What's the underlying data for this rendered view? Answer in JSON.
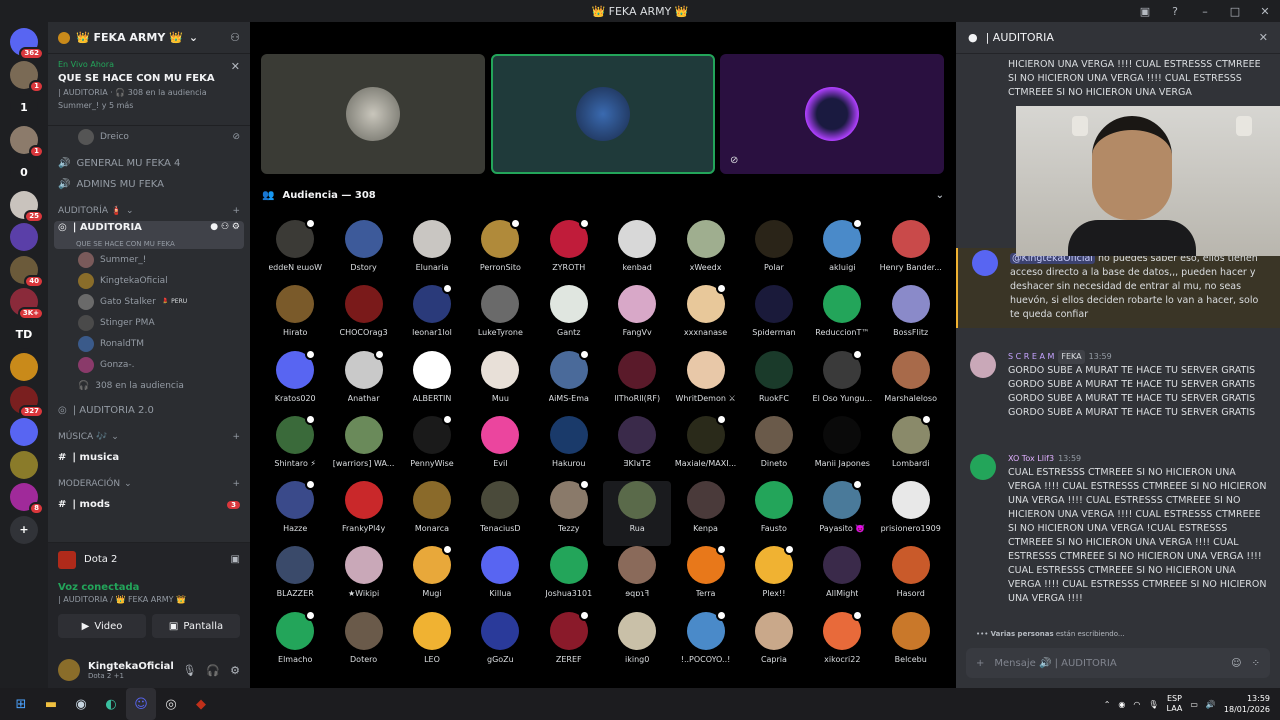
{
  "window": {
    "title": "👑 FEKA ARMY 👑"
  },
  "servers": [
    {
      "label": "",
      "badge": "362",
      "color": "#5865f2"
    },
    {
      "label": "",
      "badge": "1",
      "color": "#7a6a55"
    },
    {
      "label": "1",
      "badge": "",
      "color": "#1e1f22"
    },
    {
      "label": "",
      "badge": "1",
      "color": "#8c7b6b"
    },
    {
      "label": "0",
      "badge": "",
      "color": "#1e1f22"
    },
    {
      "label": "",
      "badge": "25",
      "color": "#c9c3bd"
    },
    {
      "label": "",
      "badge": "",
      "color": "#5a3fa8"
    },
    {
      "label": "",
      "badge": "40",
      "color": "#6b5a3a"
    },
    {
      "label": "",
      "badge": "3K+",
      "color": "#8a2a3a"
    },
    {
      "label": "TD",
      "badge": "",
      "color": "#1e1f22"
    },
    {
      "label": "",
      "badge": "",
      "color": "#c98a1a"
    },
    {
      "label": "",
      "badge": "327",
      "color": "#7a1f1f"
    },
    {
      "label": "",
      "badge": "",
      "color": "#5865f2"
    },
    {
      "label": "",
      "badge": "",
      "color": "#8a7b2a"
    },
    {
      "label": "",
      "badge": "8",
      "color": "#a02a9a"
    },
    {
      "label": "+",
      "badge": "",
      "color": "#313338"
    }
  ],
  "guild": {
    "name": "👑 FEKA ARMY 👑"
  },
  "live": {
    "status": "En Vivo Ahora",
    "title": "QUE SE HACE CON MU FEKA",
    "info": "| AUDITORIA · 🎧 308 en la audiencia",
    "users": "Summer_! y 5 más"
  },
  "channels": {
    "top_user": "Dreico",
    "general": "GENERAL MU FEKA 4",
    "admins": "ADMINS MU FEKA",
    "cat_auditoria": "AUDITORÍA 🧯",
    "auditoria": "| AUDITORIA",
    "auditoria_sub": "QUE SE HACE CON MU FEKA",
    "voice_users": [
      {
        "name": "Summer_!",
        "tag": ""
      },
      {
        "name": "KingtekaOficial",
        "tag": ""
      },
      {
        "name": "Gato Stalker",
        "tag": "💄 PERU"
      },
      {
        "name": "Stinger PMA",
        "tag": ""
      },
      {
        "name": "RonaldTM",
        "tag": ""
      },
      {
        "name": "Gonza-.",
        "tag": ""
      }
    ],
    "audience_count": "308 en la audiencia",
    "auditoria2": "| AUDITORIA 2.0",
    "cat_musica": "MÚSICA 🎶",
    "musica": "| musica",
    "cat_moderacion": "MODERACIÓN",
    "mods": "| mods",
    "mods_badge": "3"
  },
  "game": {
    "name": "Dota 2"
  },
  "voice": {
    "status": "Voz conectada",
    "server": "| AUDITORIA / 👑 FEKA ARMY 👑",
    "video": "Video",
    "screen": "Pantalla"
  },
  "user": {
    "name": "KingtekaOficial",
    "status": "Dota 2 +1"
  },
  "audience": {
    "header": "Audiencia — 308"
  },
  "audience_members": [
    {
      "name": "ɐddɐN ɐɯoW",
      "color": "#3b3a36"
    },
    {
      "name": "Dstory",
      "color": "#3d5a9a"
    },
    {
      "name": "Elunaria",
      "color": "#c9c6c2"
    },
    {
      "name": "PerronSito",
      "color": "#b08a3a"
    },
    {
      "name": "ZYROTH",
      "color": "#c01c3a"
    },
    {
      "name": "kenbad",
      "color": "#d8d8d8"
    },
    {
      "name": "xWeedx",
      "color": "#9fae8f"
    },
    {
      "name": "Polar",
      "color": "#2a2418"
    },
    {
      "name": "akluigi",
      "color": "#4a8ac9"
    },
    {
      "name": "Henry Bander...",
      "color": "#c94a4a"
    },
    {
      "name": "Hirato",
      "color": "#7a5a2a"
    },
    {
      "name": "CHOCOrag3",
      "color": "#7a1a1a"
    },
    {
      "name": "leonar1lol",
      "color": "#2a3a7a"
    },
    {
      "name": "LukeTyrone",
      "color": "#6a6a6a"
    },
    {
      "name": "Gantz",
      "color": "#e0e6e0"
    },
    {
      "name": "FangVv",
      "color": "#d8a8c8"
    },
    {
      "name": "xxxnanase",
      "color": "#e8c89a"
    },
    {
      "name": "Spiderman",
      "color": "#1a1a3a"
    },
    {
      "name": "ReduccionT™",
      "color": "#23a55a"
    },
    {
      "name": "BossFlitz",
      "color": "#8a8ac9"
    },
    {
      "name": "Kratos020",
      "color": "#5865f2"
    },
    {
      "name": "Anathar",
      "color": "#c9c9c9"
    },
    {
      "name": "ALBERTIN",
      "color": "#ffffff"
    },
    {
      "name": "Muu",
      "color": "#e8e0d8"
    },
    {
      "name": "AiMS-Ema",
      "color": "#4a6a9a"
    },
    {
      "name": "lIThoRll(RF)",
      "color": "#5a1a2a"
    },
    {
      "name": "WhritDemon ⚔",
      "color": "#e8c8a8"
    },
    {
      "name": "RuokFC",
      "color": "#1a3a2a"
    },
    {
      "name": "El Oso Yungu...",
      "color": "#3a3a3a"
    },
    {
      "name": "Marshaleloso",
      "color": "#a86a4a"
    },
    {
      "name": "Shintaro ⚡",
      "color": "#3a6a3a"
    },
    {
      "name": "[warriors] WA...",
      "color": "#6a8a5a"
    },
    {
      "name": "PennyWise",
      "color": "#1a1a1a"
    },
    {
      "name": "Evil",
      "color": "#eb459e"
    },
    {
      "name": "Hakurou",
      "color": "#1a3a6a"
    },
    {
      "name": "ƎKIᴚTƧ",
      "color": "#3a2a4a"
    },
    {
      "name": "Maxiale/MAXI...",
      "color": "#2a2a1a"
    },
    {
      "name": "Dineto",
      "color": "#6a5a4a"
    },
    {
      "name": "Manii Japones",
      "color": "#0a0a0a"
    },
    {
      "name": "Lombardi",
      "color": "#8a8a6a"
    },
    {
      "name": "Hazze",
      "color": "#3a4a8a"
    },
    {
      "name": "FrankyPl4y",
      "color": "#c9282a"
    },
    {
      "name": "Monarca",
      "color": "#8a6a2a"
    },
    {
      "name": "TenaciusD",
      "color": "#4a4a3a"
    },
    {
      "name": "Tezzy",
      "color": "#8a7a6a"
    },
    {
      "name": "Rua",
      "color": "#5a6a4a"
    },
    {
      "name": "Kenpa",
      "color": "#4a3a3a"
    },
    {
      "name": "Fausto",
      "color": "#23a55a"
    },
    {
      "name": "Payasito 👿",
      "color": "#4a7a9a"
    },
    {
      "name": "prisionero1909",
      "color": "#e8e8e8"
    },
    {
      "name": "BLAZZER",
      "color": "#3a4a6a"
    },
    {
      "name": "★Wikipi",
      "color": "#c9a8b8"
    },
    {
      "name": "Mugi",
      "color": "#e8a83a"
    },
    {
      "name": "Killua",
      "color": "#5865f2"
    },
    {
      "name": "Joshua3101",
      "color": "#23a55a"
    },
    {
      "name": "ɘqɒɿꟻ",
      "color": "#8a6a5a"
    },
    {
      "name": "Terra",
      "color": "#e8781a"
    },
    {
      "name": "Plex!!",
      "color": "#f0b232"
    },
    {
      "name": "AllMight",
      "color": "#3a2a4a"
    },
    {
      "name": "Hasord",
      "color": "#c95a2a"
    },
    {
      "name": "Elmacho",
      "color": "#23a55a"
    },
    {
      "name": "Dotero",
      "color": "#6a5a4a"
    },
    {
      "name": "LEO",
      "color": "#f0b232"
    },
    {
      "name": "gGoZu",
      "color": "#2a3a9a"
    },
    {
      "name": "ZEREF",
      "color": "#8a1a2a"
    },
    {
      "name": "iking0",
      "color": "#c9c0a8"
    },
    {
      "name": "!..POCOYO..!",
      "color": "#4a8ac9"
    },
    {
      "name": "Capria",
      "color": "#c9a88a"
    },
    {
      "name": "xikocri22",
      "color": "#e86a3a"
    },
    {
      "name": "Belcebu",
      "color": "#c9782a"
    }
  ],
  "chat": {
    "header": "| AUDITORIA",
    "msg1_text": "HICIERON UNA VERGA !!!! CUAL ESTRESSS CTMREEE SI NO HICIERON UNA VERGA !!!! CUAL ESTRESSS CTMREEE SI NO HICIERON UNA VERGA",
    "msg2_mention": "@KingtekaOficial",
    "msg2_text": "no puedes saber eso, ellos tienen acceso directo a la base de datos,,, pueden hacer y deshacer sin necesidad de entrar al mu, no seas huevón, si ellos deciden robarte lo van a hacer, solo te queda confiar",
    "msg3_author": "S C R E A M",
    "msg3_tag": "FEKA",
    "msg3_time": "13:59",
    "msg3_text": "GORDO SUBE A MURAT TE HACE TU SERVER GRATIS GORDO SUBE A MURAT TE HACE TU SERVER GRATIS GORDO SUBE A MURAT TE HACE TU SERVER GRATIS GORDO SUBE A MURAT TE HACE TU SERVER GRATIS",
    "msg4_author": "XO Tox Llif3",
    "msg4_time": "13:59",
    "msg4_text": "CUAL ESTRESSS CTMREEE SI NO HICIERON UNA VERGA !!!! CUAL ESTRESSS CTMREEE SI NO HICIERON UNA VERGA !!!! CUAL ESTRESSS CTMREEE SI NO HICIERON UNA VERGA !!!! CUAL ESTRESSS CTMREEE SI NO HICIERON UNA VERGA !CUAL ESTRESSS CTMREEE SI NO HICIERON UNA VERGA !!!! CUAL ESTRESSS CTMREEE SI NO HICIERON UNA VERGA !!!! CUAL ESTRESSS CTMREEE SI NO HICIERON UNA VERGA !!!! CUAL ESTRESSS CTMREEE SI NO HICIERON UNA VERGA !!!!",
    "typing_who": "Varias personas",
    "typing_rest": "están escribiendo...",
    "composer_placeholder": "Mensaje 🔊 | AUDITORIA"
  },
  "taskbar": {
    "lang1": "ESP",
    "lang2": "LAA",
    "time": "13:59",
    "date": "18/01/2026"
  },
  "colors": {
    "accent": "#5865f2",
    "online": "#23a55a",
    "danger": "#da373c"
  }
}
